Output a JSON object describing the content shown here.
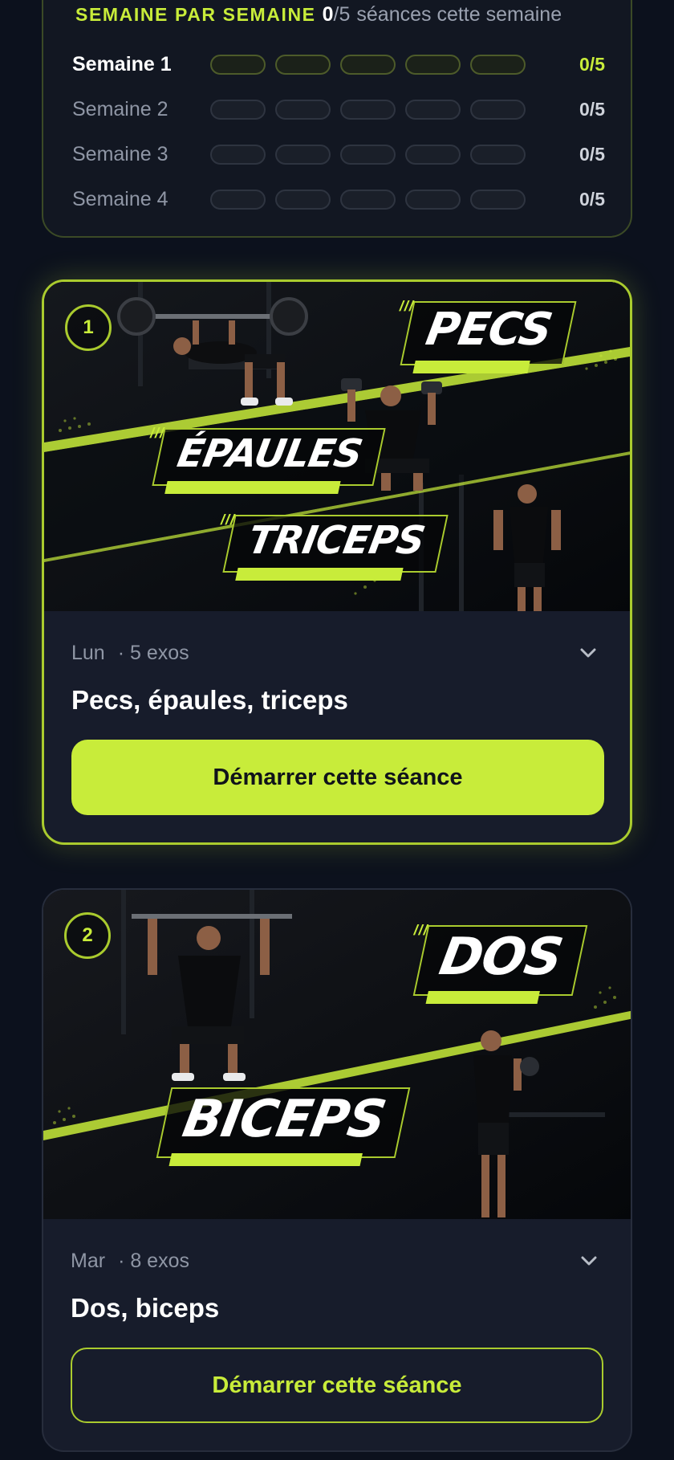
{
  "weekly_progress": {
    "title": "SEMAINE PAR SEMAINE",
    "count_done": "0",
    "count_total": "/5",
    "suffix": "séances cette semaine",
    "weeks": [
      {
        "label": "Semaine 1",
        "score": "0/5",
        "completed_sessions": 0,
        "current": true
      },
      {
        "label": "Semaine 2",
        "score": "0/5",
        "completed_sessions": 0,
        "current": false
      },
      {
        "label": "Semaine 3",
        "score": "0/5",
        "completed_sessions": 0,
        "current": false
      },
      {
        "label": "Semaine 4",
        "score": "0/5",
        "completed_sessions": 0,
        "current": false
      }
    ]
  },
  "sessions": [
    {
      "number": "1",
      "day": "Lun",
      "exercises": "· 5 exos",
      "title": "Pecs, épaules, triceps",
      "banner_tags": [
        "PECS",
        "ÉPAULES",
        "TRICEPS"
      ],
      "button_label": "Démarrer cette séance",
      "active": true,
      "chevron_icon": "chevron-down-icon"
    },
    {
      "number": "2",
      "day": "Mar",
      "exercises": "· 8 exos",
      "title": "Dos, biceps",
      "banner_tags": [
        "DOS",
        "BICEPS"
      ],
      "button_label": "Démarrer cette séance",
      "active": false,
      "chevron_icon": "chevron-down-icon"
    }
  ],
  "colors": {
    "accent": "#c8ec3a",
    "background": "#0c111d",
    "card": "#171c2b"
  }
}
